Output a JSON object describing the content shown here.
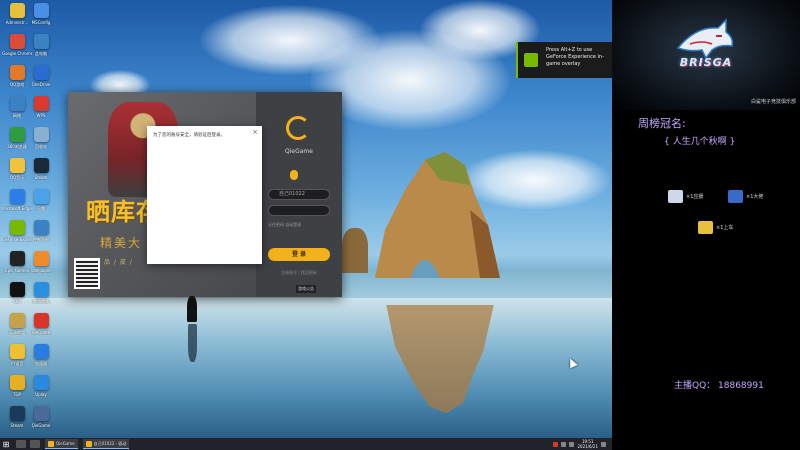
{
  "desktop": {
    "icons": [
      {
        "label": "Administr...",
        "color": "#e7c03a"
      },
      {
        "label": "MSConfig",
        "color": "#4a8ee6"
      },
      {
        "label": "Google Chrome",
        "color": "#dd4b39"
      },
      {
        "label": "此电脑",
        "color": "#3b82c4"
      },
      {
        "label": "QQ游戏",
        "color": "#e07a2a"
      },
      {
        "label": "OneDrive",
        "color": "#2b6cd2"
      },
      {
        "label": "网络",
        "color": "#3b82c4"
      },
      {
        "label": "WPS",
        "color": "#d93a2f"
      },
      {
        "label": "360浏览器",
        "color": "#2e9c3f"
      },
      {
        "label": "回收站",
        "color": "#8ab0d0"
      },
      {
        "label": "QQ音乐",
        "color": "#f1c23a"
      },
      {
        "label": "Steam",
        "color": "#1b2838"
      },
      {
        "label": "Microsoft Edge",
        "color": "#2b7de9"
      },
      {
        "label": "迅雷",
        "color": "#4aa3e8"
      },
      {
        "label": "GeForce Experience",
        "color": "#76b900"
      },
      {
        "label": "控制面板",
        "color": "#3b82c4"
      },
      {
        "label": "Epic Games",
        "color": "#222"
      },
      {
        "label": "Wallpaper",
        "color": "#f08a2a"
      },
      {
        "label": "QQ",
        "color": "#111"
      },
      {
        "label": "腾讯视频",
        "color": "#2a8fe0"
      },
      {
        "label": "英雄联盟",
        "color": "#c8a24a"
      },
      {
        "label": "WeGame",
        "color": "#d8352a"
      },
      {
        "label": "YY语音",
        "color": "#f0c030"
      },
      {
        "label": "加速器",
        "color": "#2a7de0"
      },
      {
        "label": "TGP",
        "color": "#e8b020"
      },
      {
        "label": "Uplay",
        "color": "#2a8ae0"
      },
      {
        "label": "Steam",
        "color": "#1b3a5a"
      },
      {
        "label": "QieGame",
        "color": "#4a6a9a"
      }
    ]
  },
  "launcher": {
    "promo_big": "晒库存",
    "promo_sub": "精美大",
    "promo_small": "品 / 皮 /",
    "app_name": "QieGame",
    "account_value": "自己01022",
    "password_value": "",
    "remember_text": "记住密码   自动登录",
    "login_label": "登 录",
    "bottom_text": "注册账号 | 找回密码",
    "corner_label": "游戏公告"
  },
  "dialog": {
    "message": "为了您的账号安全，请验证后登录。",
    "close_glyph": "×"
  },
  "nvidia": {
    "text": "Press Alt+Z to use GeForce Experience in-game overlay"
  },
  "taskbar": {
    "start_glyph": "⊞",
    "apps": [
      {
        "label": "QieGame",
        "color": "#f3b21a"
      },
      {
        "label": "自己01022 - 驱动",
        "color": "#f3b21a"
      }
    ],
    "clock_time": "19:51",
    "clock_date": "2021/6/21"
  },
  "overlay": {
    "logo_text": "BRISGA",
    "club_name": "白鲨电子竞技俱乐部",
    "weekly_title": "周榜冠名:",
    "champion": "{  人生几个秋啊  }",
    "gifts": [
      {
        "label": "×1应援",
        "color": "#cfd8e8"
      },
      {
        "label": "×1大佬",
        "color": "#3a6ac8"
      },
      {
        "label": "×1上车",
        "color": "#e8c040"
      }
    ],
    "qq_text": "主播QQ：  18868991"
  }
}
